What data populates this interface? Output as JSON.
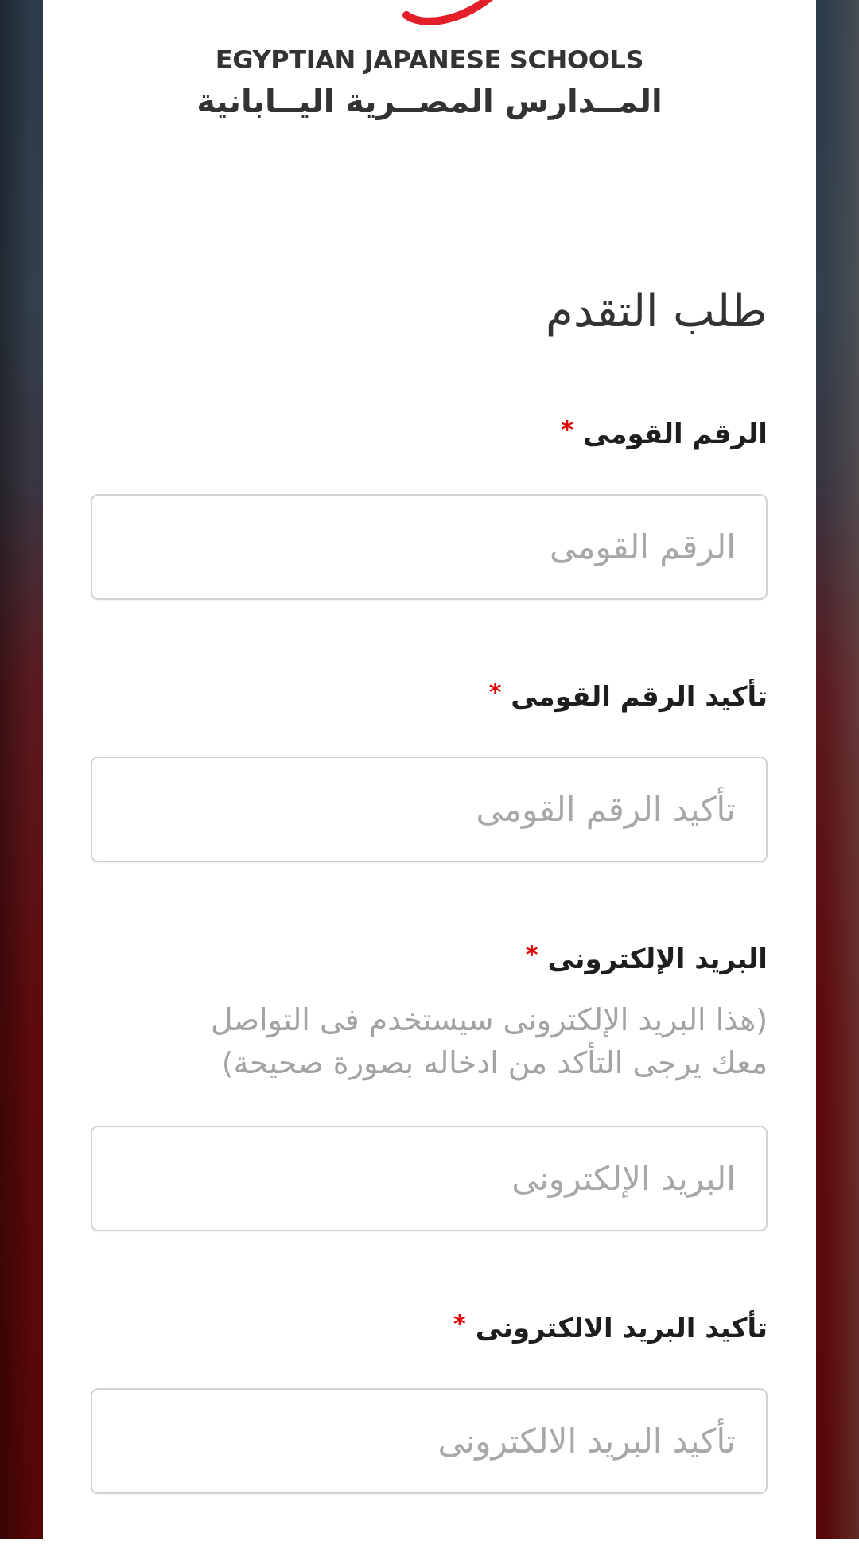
{
  "logo": {
    "title_en": "EGYPTIAN JAPANESE SCHOOLS",
    "title_ar": "المــدارس المصــرية اليــابانية"
  },
  "form": {
    "title": "طلب التقدم",
    "fields": [
      {
        "label": "الرقم القومى",
        "required_mark": "*",
        "placeholder": "الرقم القومى"
      },
      {
        "label": "تأكيد الرقم القومى",
        "required_mark": "*",
        "placeholder": "تأكيد الرقم القومى"
      },
      {
        "label": "البريد الإلكترونى",
        "required_mark": "*",
        "hint": "(هذا البريد الإلكترونى سيستخدم فى التواصل معك يرجى التأكد من ادخاله بصورة صحيحة)",
        "placeholder": "البريد الإلكترونى"
      },
      {
        "label": "تأكيد البريد الالكترونى",
        "required_mark": "*",
        "placeholder": "تأكيد البريد الالكترونى"
      }
    ]
  }
}
